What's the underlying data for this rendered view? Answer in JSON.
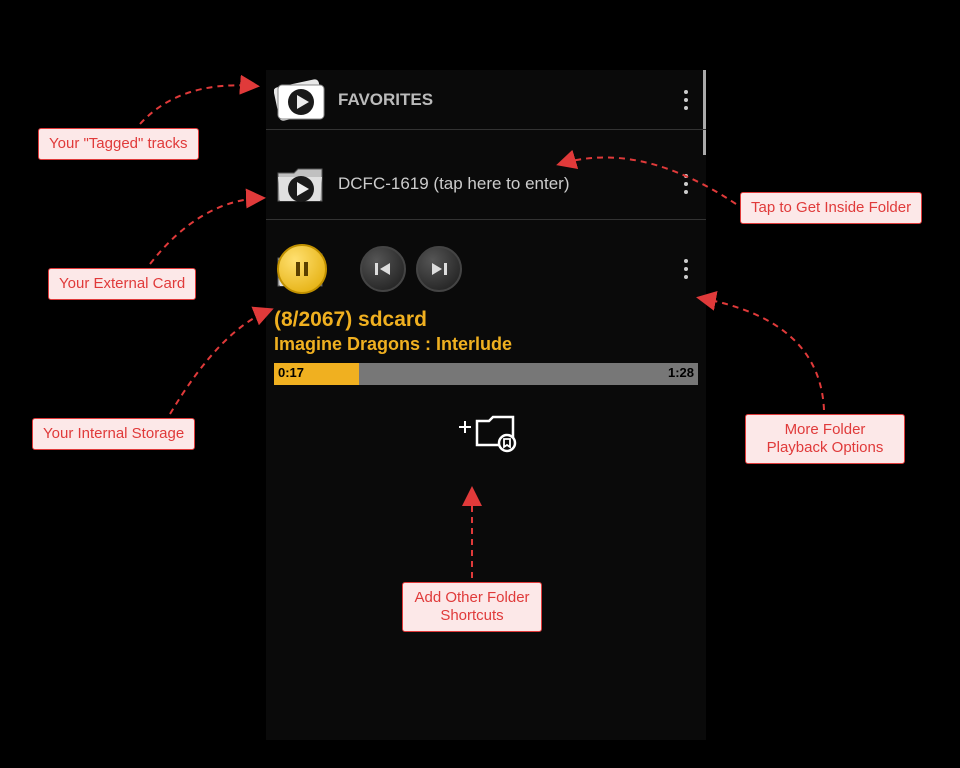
{
  "favorites": {
    "label": "FAVORITES"
  },
  "folder1": {
    "label": "DCFC-1619 (tap here to enter)"
  },
  "player": {
    "counter": "(8/2067)  sdcard",
    "track": "Imagine Dragons : Interlude",
    "time_elapsed": "0:17",
    "time_total": "1:28",
    "progress_percent": 20
  },
  "callouts": {
    "tagged": "Your \"Tagged\" tracks",
    "external": "Your External Card",
    "internal": "Your Internal Storage",
    "inside": "Tap to Get Inside Folder",
    "more": "More Folder Playback Options",
    "add": "Add Other Folder Shortcuts"
  }
}
